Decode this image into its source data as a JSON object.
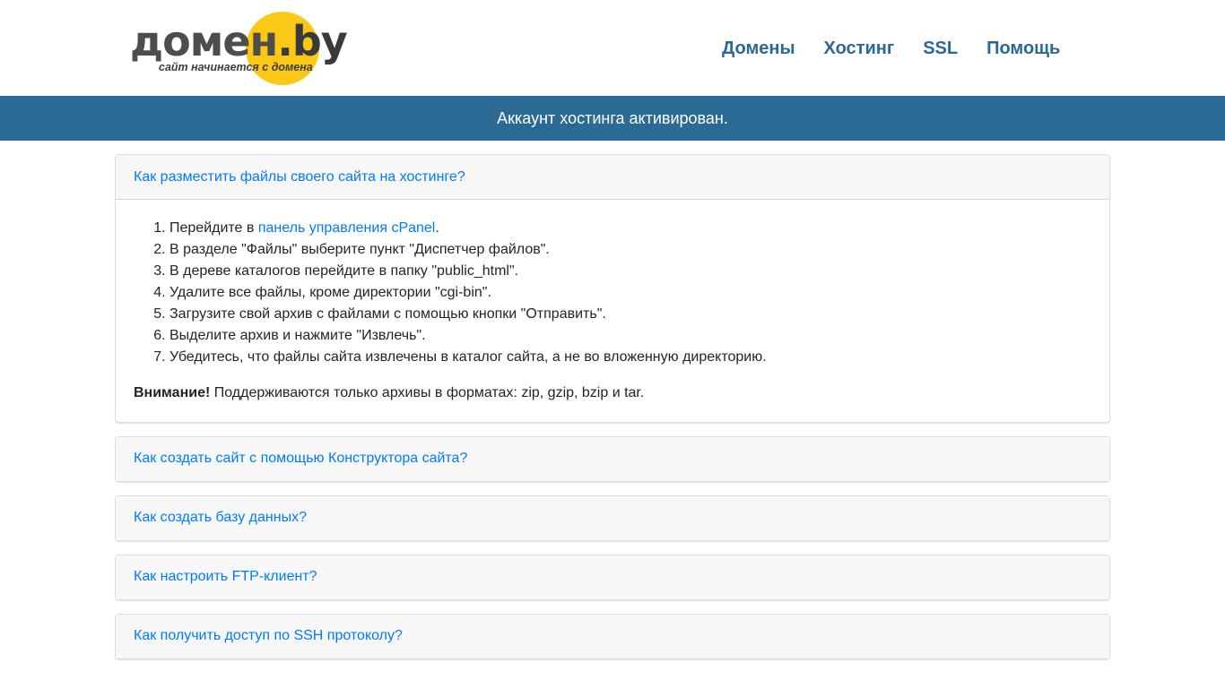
{
  "header": {
    "logo": {
      "main_text": "домен",
      "suffix_text": ".by",
      "tagline": "сайт начинается с домена"
    },
    "nav": [
      {
        "label": "Домены"
      },
      {
        "label": "Хостинг"
      },
      {
        "label": "SSL"
      },
      {
        "label": "Помощь"
      }
    ]
  },
  "banner": {
    "text": "Аккаунт хостинга активирован."
  },
  "accordion": [
    {
      "title": "Как разместить файлы своего сайта на хостинге?",
      "open": true,
      "steps": {
        "step1_prefix": "Перейдите в ",
        "step1_link": "панель управления cPanel",
        "step1_suffix": ".",
        "step2": "В разделе \"Файлы\" выберите пункт \"Диспетчер файлов\".",
        "step3": "В дереве каталогов перейдите в папку \"public_html\".",
        "step4": "Удалите все файлы, кроме директории \"cgi-bin\".",
        "step5": "Загрузите свой архив с файлами с помощью кнопки \"Отправить\".",
        "step6": "Выделите архив и нажмите \"Извлечь\".",
        "step7": "Убедитесь, что файлы сайта извлечены в каталог сайта, а не во вложенную директорию."
      },
      "note_label": "Внимание!",
      "note_text": " Поддерживаются только архивы в форматах: zip, gzip, bzip и tar."
    },
    {
      "title": "Как создать сайт с помощью Конструктора сайта?",
      "open": false
    },
    {
      "title": "Как создать базу данных?",
      "open": false
    },
    {
      "title": "Как настроить FTP-клиент?",
      "open": false
    },
    {
      "title": "Как получить доступ по SSH протоколу?",
      "open": false
    }
  ],
  "colors": {
    "brand_yellow": "#fbc816",
    "nav_link": "#2c6895",
    "banner_bg": "#2a6a94",
    "link": "#007bff"
  }
}
